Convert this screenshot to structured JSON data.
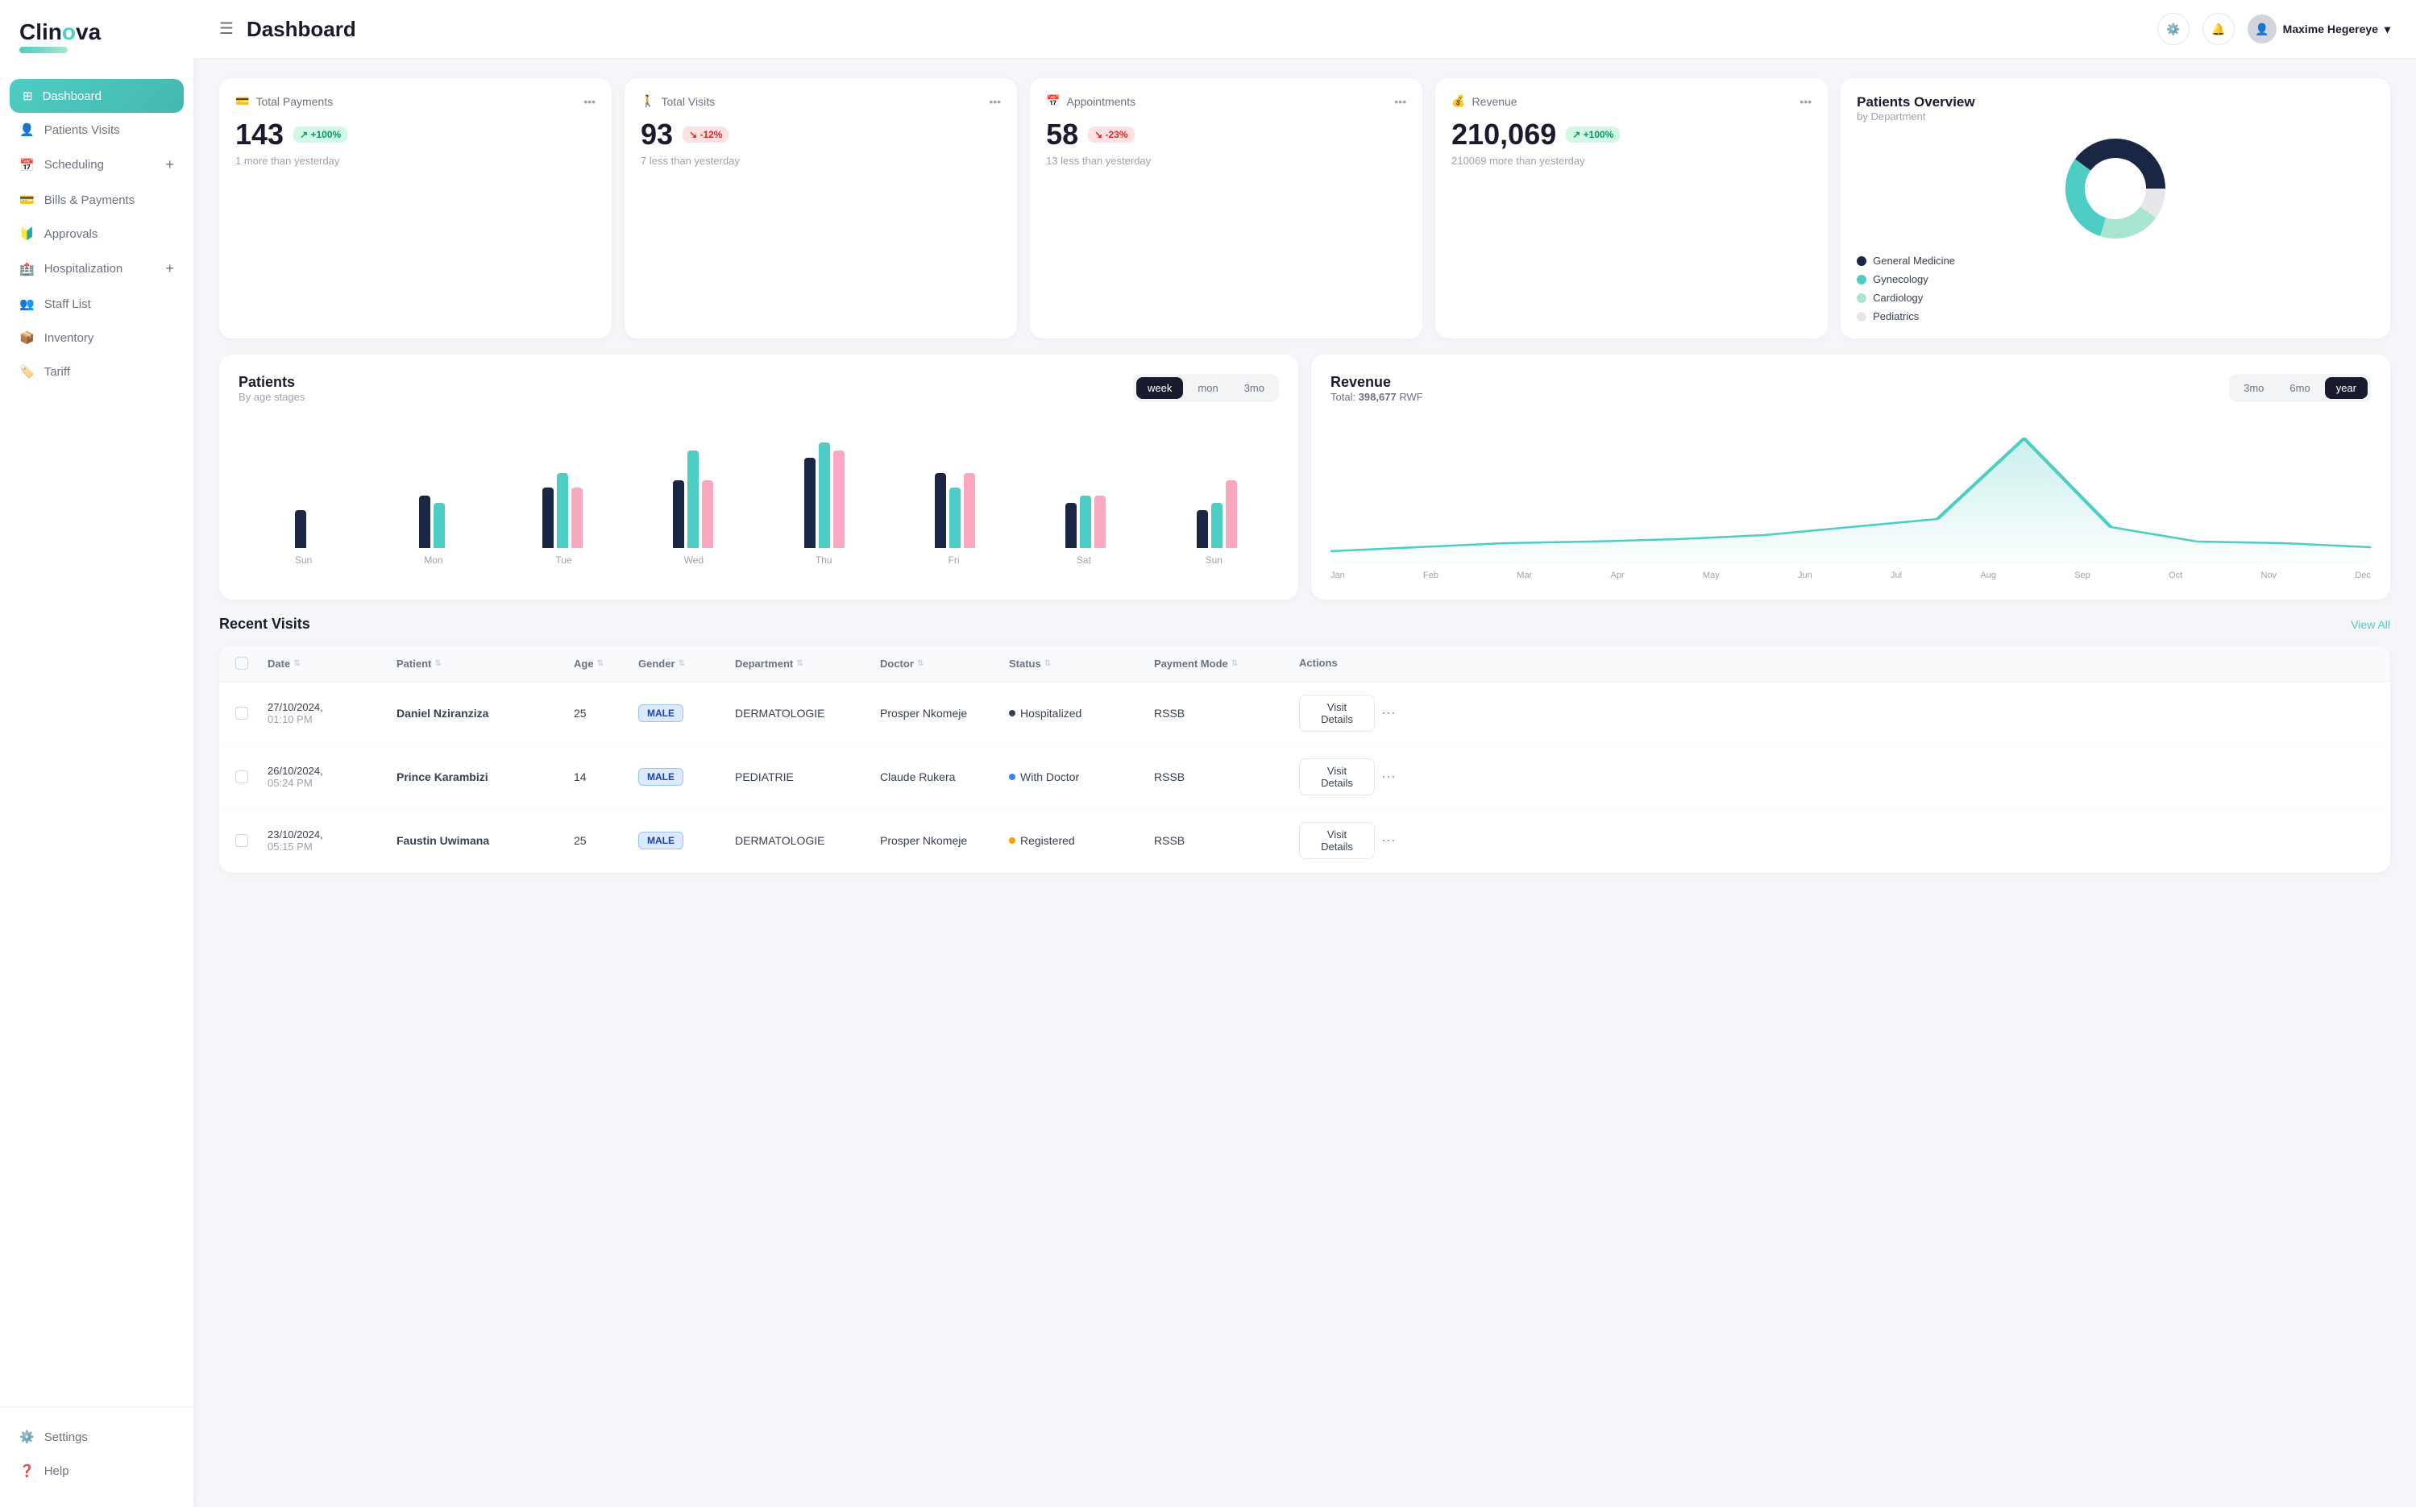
{
  "app": {
    "name": "Clinova",
    "page_title": "Dashboard"
  },
  "sidebar": {
    "items": [
      {
        "id": "dashboard",
        "label": "Dashboard",
        "icon": "grid",
        "active": true,
        "has_plus": false
      },
      {
        "id": "patients-visits",
        "label": "Patients Visits",
        "icon": "user",
        "active": false,
        "has_plus": false
      },
      {
        "id": "scheduling",
        "label": "Scheduling",
        "icon": "calendar",
        "active": false,
        "has_plus": true
      },
      {
        "id": "bills-payments",
        "label": "Bills & Payments",
        "icon": "credit-card",
        "active": false,
        "has_plus": false
      },
      {
        "id": "approvals",
        "label": "Approvals",
        "icon": "shield",
        "active": false,
        "has_plus": false
      },
      {
        "id": "hospitalization",
        "label": "Hospitalization",
        "icon": "hospital",
        "active": false,
        "has_plus": true
      },
      {
        "id": "staff-list",
        "label": "Staff List",
        "icon": "users",
        "active": false,
        "has_plus": false
      },
      {
        "id": "inventory",
        "label": "Inventory",
        "icon": "box",
        "active": false,
        "has_plus": false
      },
      {
        "id": "tariff",
        "label": "Tariff",
        "icon": "tag",
        "active": false,
        "has_plus": false
      }
    ],
    "bottom_items": [
      {
        "id": "settings",
        "label": "Settings",
        "icon": "gear"
      },
      {
        "id": "help",
        "label": "Help",
        "icon": "question"
      }
    ]
  },
  "header": {
    "hamburger_label": "☰",
    "title": "Dashboard",
    "user_name": "Maxime Hegereye"
  },
  "stats": [
    {
      "id": "total-payments",
      "icon": "💳",
      "label": "Total Payments",
      "value": "143",
      "badge": "+100%",
      "badge_type": "positive",
      "sub": "1 more than yesterday"
    },
    {
      "id": "total-visits",
      "icon": "🚶",
      "label": "Total Visits",
      "value": "93",
      "badge": "-12%",
      "badge_type": "negative",
      "sub": "7 less than yesterday"
    },
    {
      "id": "appointments",
      "icon": "📅",
      "label": "Appointments",
      "value": "58",
      "badge": "-23%",
      "badge_type": "negative",
      "sub": "13 less than yesterday"
    },
    {
      "id": "revenue",
      "icon": "💰",
      "label": "Revenue",
      "value": "210,069",
      "badge": "+100%",
      "badge_type": "positive",
      "sub": "210069 more than yesterday"
    }
  ],
  "patients_chart": {
    "title": "Patients",
    "sub": "By age stages",
    "tabs": [
      "week",
      "mon",
      "3mo"
    ],
    "active_tab": "week",
    "days": [
      "Sun",
      "Mon",
      "Tue",
      "Wed",
      "Thu",
      "Fri",
      "Sat",
      "Sun"
    ],
    "bars": [
      {
        "day": "Sun",
        "navy": 50,
        "teal": 0,
        "pink": 0
      },
      {
        "day": "Mon",
        "navy": 70,
        "teal": 60,
        "pink": 0
      },
      {
        "day": "Tue",
        "navy": 80,
        "teal": 100,
        "pink": 80
      },
      {
        "day": "Wed",
        "navy": 90,
        "teal": 130,
        "pink": 90
      },
      {
        "day": "Thu",
        "navy": 120,
        "teal": 140,
        "pink": 130
      },
      {
        "day": "Fri",
        "navy": 100,
        "teal": 80,
        "pink": 100
      },
      {
        "day": "Sat",
        "navy": 60,
        "teal": 70,
        "pink": 70
      },
      {
        "day": "Sun",
        "navy": 50,
        "teal": 60,
        "pink": 90
      }
    ]
  },
  "revenue_chart": {
    "title": "Revenue",
    "total_label": "Total:",
    "total_value": "398,677",
    "currency": "RWF",
    "tabs": [
      "3mo",
      "6mo",
      "year"
    ],
    "active_tab": "year",
    "x_labels": [
      "Jan",
      "Feb",
      "Mar",
      "Apr",
      "May",
      "Jun",
      "Jul",
      "Aug",
      "Sep",
      "Oct",
      "Nov",
      "Dec"
    ],
    "peak_month": "Sep"
  },
  "patients_overview": {
    "title": "Patients Overview",
    "sub": "by Department",
    "segments": [
      {
        "label": "General Medicine",
        "color": "#1a2744",
        "value": 40
      },
      {
        "label": "Gynecology",
        "color": "#4ecdc4",
        "value": 30
      },
      {
        "label": "Cardiology",
        "color": "#a8e6cf",
        "value": 20
      },
      {
        "label": "Pediatrics",
        "color": "#e5e7eb",
        "value": 10
      }
    ]
  },
  "recent_visits": {
    "title": "Recent Visits",
    "view_all": "View All",
    "columns": [
      "Date",
      "Patient",
      "Age",
      "Gender",
      "Department",
      "Doctor",
      "Status",
      "Payment Mode",
      "Actions"
    ],
    "rows": [
      {
        "date": "27/10/2024,",
        "time": "01:10 PM",
        "patient": "Daniel Nziranziza",
        "age": "25",
        "gender": "MALE",
        "department": "DERMATOLOGIE",
        "doctor": "Prosper Nkomeje",
        "status": "Hospitalized",
        "status_color": "#374151",
        "payment": "RSSB"
      },
      {
        "date": "26/10/2024,",
        "time": "05:24 PM",
        "patient": "Prince Karambizi",
        "age": "14",
        "gender": "MALE",
        "department": "PEDIATRIE",
        "doctor": "Claude Rukera",
        "status": "With Doctor",
        "status_color": "#3b82f6",
        "payment": "RSSB"
      },
      {
        "date": "23/10/2024,",
        "time": "05:15 PM",
        "patient": "Faustin Uwimana",
        "age": "25",
        "gender": "MALE",
        "department": "DERMATOLOGIE",
        "doctor": "Prosper Nkomeje",
        "status": "Registered",
        "status_color": "#f59e0b",
        "payment": "RSSB"
      }
    ],
    "action_label": "Visit Details"
  }
}
